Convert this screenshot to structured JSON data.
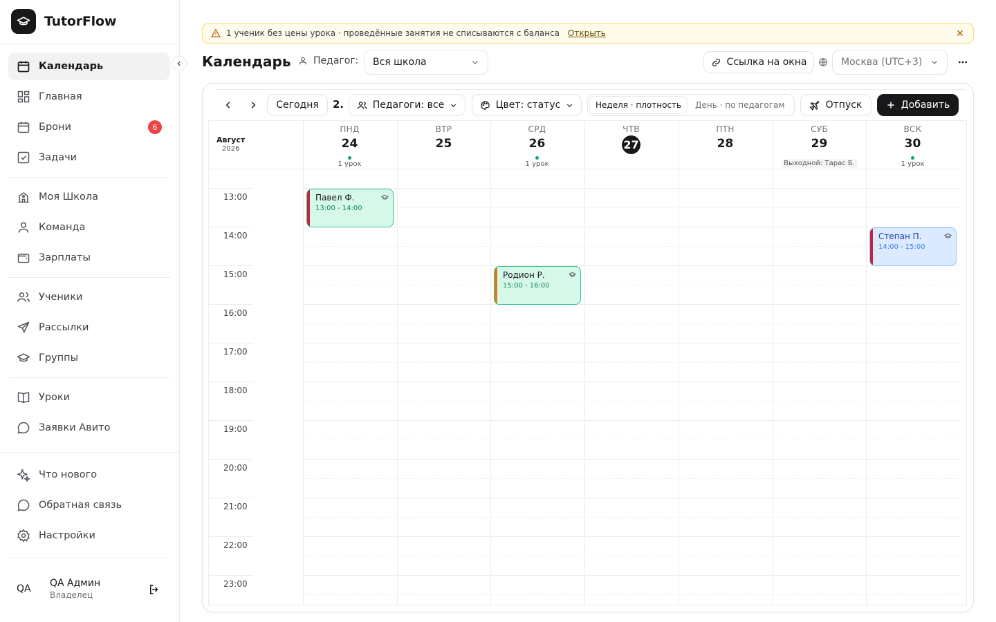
{
  "app": {
    "name": "TutorFlow"
  },
  "sidebar": {
    "items": [
      {
        "label": "Календарь",
        "active": true,
        "icon": "calendar-icon"
      },
      {
        "label": "Главная",
        "icon": "dashboard-icon"
      },
      {
        "label": "Брони",
        "icon": "calendar-icon",
        "badge": "6"
      },
      {
        "label": "Задачи",
        "icon": "checkbox-icon"
      },
      {
        "label": "Моя Школа",
        "icon": "school-icon"
      },
      {
        "label": "Команда",
        "icon": "team-icon"
      },
      {
        "label": "Зарплаты",
        "icon": "wallet-icon"
      },
      {
        "label": "Ученики",
        "icon": "students-icon"
      },
      {
        "label": "Рассылки",
        "icon": "send-icon"
      },
      {
        "label": "Группы",
        "icon": "graduation-cap-icon"
      },
      {
        "label": "Уроки",
        "icon": "book-icon"
      },
      {
        "label": "Заявки Авито",
        "icon": "chat-icon"
      },
      {
        "label": "Что нового",
        "icon": "sparkles-icon"
      },
      {
        "label": "Обратная связь",
        "icon": "chat-icon"
      },
      {
        "label": "Настройки",
        "icon": "gear-icon"
      }
    ],
    "user": {
      "initials": "QA",
      "name": "QA Админ",
      "role": "Владелец"
    }
  },
  "banner": {
    "text": "1 ученик без цены урока · проведённые занятия не списываются с баланса",
    "link": "Открыть"
  },
  "header": {
    "title": "Календарь",
    "teacher_label": "Педагог:",
    "teacher_value": "Вся школа",
    "link_button": "Ссылка на окна",
    "timezone": "Москва (UTC+3)"
  },
  "toolbar": {
    "today": "Сегодня",
    "week_number": "2.",
    "teachers_filter": "Педагоги: все",
    "color_filter": "Цвет: статус",
    "view_week": "Неделя · плотность",
    "view_day": "День · по педагогам",
    "vacation": "Отпуск",
    "add": "Добавить"
  },
  "calendar": {
    "month": "Август",
    "year": "2026",
    "days": [
      {
        "dow": "ПНД",
        "num": "24",
        "sub": "1 урок",
        "dot": true
      },
      {
        "dow": "ВТР",
        "num": "25"
      },
      {
        "dow": "СРД",
        "num": "26",
        "sub": "1 урок",
        "dot": true
      },
      {
        "dow": "ЧТВ",
        "num": "27",
        "today": true
      },
      {
        "dow": "ПТН",
        "num": "28"
      },
      {
        "dow": "СУБ",
        "num": "29",
        "off": "Выходной: Тарас Б."
      },
      {
        "dow": "ВСК",
        "num": "30",
        "sub": "1 урок",
        "dot": true
      }
    ],
    "hours": [
      "13:00",
      "14:00",
      "15:00",
      "16:00",
      "17:00",
      "18:00",
      "19:00",
      "20:00",
      "21:00",
      "22:00",
      "23:00"
    ],
    "events": [
      {
        "name": "Павел Ф.",
        "time": "13:00 - 14:00",
        "style": "green",
        "bar": "#c0263f"
      },
      {
        "name": "Родион Р.",
        "time": "15:00 - 16:00",
        "style": "green",
        "bar": "#e07b12"
      },
      {
        "name": "Степан П.",
        "time": "14:00 - 15:00",
        "style": "blue",
        "bar": "#c0263f"
      }
    ]
  }
}
